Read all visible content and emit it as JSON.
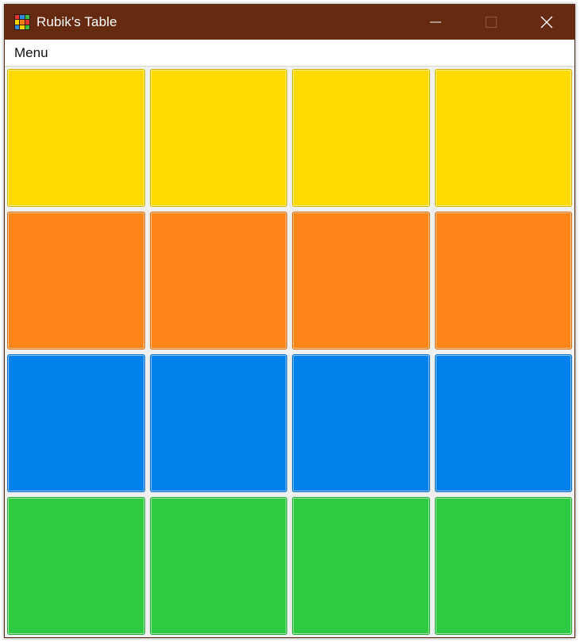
{
  "window": {
    "title": "Rubik's Table",
    "titlebar_color": "#652a10",
    "app_icon_colors": [
      "#e8352e",
      "#2f8ce0",
      "#3dbe3d",
      "#ffd400",
      "#ff7f1a",
      "#e8352e",
      "#2f8ce0",
      "#ffd400",
      "#3dbe3d"
    ],
    "controls": {
      "minimize_icon": "minimize-icon",
      "maximize_icon": "maximize-icon",
      "close_icon": "close-icon"
    }
  },
  "menu": {
    "items": [
      {
        "label": "Menu"
      }
    ]
  },
  "board": {
    "rows": 4,
    "columns": 4,
    "colors": [
      [
        "#fedb00",
        "#fedb00",
        "#fedb00",
        "#fedb00"
      ],
      [
        "#fe8518",
        "#fe8518",
        "#fe8518",
        "#fe8518"
      ],
      [
        "#0081ec",
        "#0081ec",
        "#0081ec",
        "#0081ec"
      ],
      [
        "#2ecb42",
        "#2ecb42",
        "#2ecb42",
        "#2ecb42"
      ]
    ]
  }
}
